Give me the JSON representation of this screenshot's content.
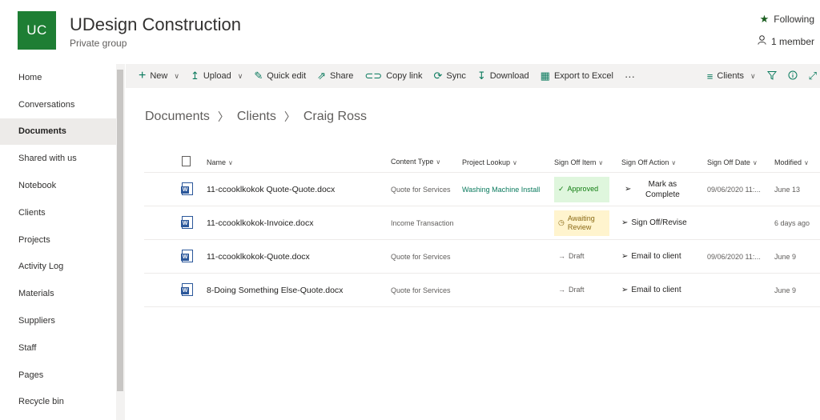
{
  "header": {
    "logo": "UC",
    "title": "UDesign Construction",
    "subtitle": "Private group",
    "following": "Following",
    "members": "1 member"
  },
  "sidebar": {
    "items": [
      {
        "label": "Home"
      },
      {
        "label": "Conversations"
      },
      {
        "label": "Documents",
        "active": true
      },
      {
        "label": "Shared with us"
      },
      {
        "label": "Notebook"
      },
      {
        "label": "Clients"
      },
      {
        "label": "Projects"
      },
      {
        "label": "Activity Log"
      },
      {
        "label": "Materials"
      },
      {
        "label": "Suppliers"
      },
      {
        "label": "Staff"
      },
      {
        "label": "Pages"
      },
      {
        "label": "Recycle bin"
      }
    ]
  },
  "commandbar": {
    "new": "New",
    "upload": "Upload",
    "quick_edit": "Quick edit",
    "share": "Share",
    "copy_link": "Copy link",
    "sync": "Sync",
    "download": "Download",
    "export": "Export to Excel",
    "more": "···",
    "view": "Clients"
  },
  "breadcrumb": [
    "Documents",
    "Clients",
    "Craig Ross"
  ],
  "table": {
    "headers": {
      "name": "Name",
      "content_type": "Content Type",
      "project_lookup": "Project Lookup",
      "sign_off_item": "Sign Off Item",
      "sign_off_action": "Sign Off Action",
      "sign_off_date": "Sign Off Date",
      "modified": "Modified"
    },
    "rows": [
      {
        "name": "11-ccooklkokok Quote-Quote.docx",
        "content_type": "Quote for Services",
        "project_lookup": "Washing Machine Install",
        "sign_off_item": "Approved",
        "sign_off_action": "Mark as Complete",
        "sign_off_date": "09/06/2020 11:...",
        "modified": "June 13"
      },
      {
        "name": "11-ccooklkokok-Invoice.docx",
        "content_type": "Income Transaction",
        "project_lookup": "",
        "sign_off_item": "Awaiting Review",
        "sign_off_action": "Sign Off/Revise",
        "sign_off_date": "",
        "modified": "6 days ago"
      },
      {
        "name": "11-ccooklkokok-Quote.docx",
        "content_type": "Quote for Services",
        "project_lookup": "",
        "sign_off_item": "Draft",
        "sign_off_action": "Email to client",
        "sign_off_date": "09/06/2020 11:...",
        "modified": "June 9"
      },
      {
        "name": "8-Doing Something Else-Quote.docx",
        "content_type": "Quote for Services",
        "project_lookup": "",
        "sign_off_item": "Draft",
        "sign_off_action": "Email to client",
        "sign_off_date": "",
        "modified": "June 9"
      }
    ]
  },
  "colors": {
    "brand": "#1e7e34",
    "accent": "#0a7a5d",
    "approved_bg": "#dff6dd",
    "awaiting_bg": "#fff4ce"
  }
}
